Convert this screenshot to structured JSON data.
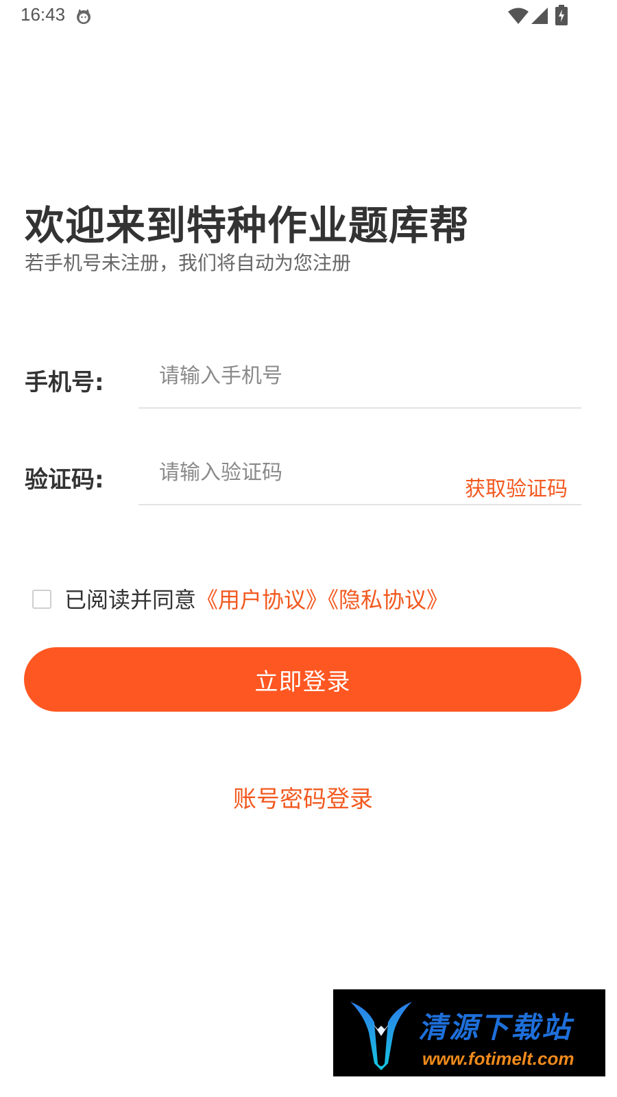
{
  "status_bar": {
    "time": "16:43",
    "icons": [
      "cat-notification-icon",
      "wifi-icon",
      "signal-icon",
      "battery-charging-icon"
    ]
  },
  "header": {
    "title": "欢迎来到特种作业题库帮",
    "subtitle": "若手机号未注册，我们将自动为您注册"
  },
  "form": {
    "phone_label": "手机号:",
    "phone_placeholder": "请输入手机号",
    "phone_value": "",
    "code_label": "验证码:",
    "code_placeholder": "请输入验证码",
    "code_value": "",
    "get_code_label": "获取验证码"
  },
  "agreement": {
    "checked": false,
    "prefix": "已阅读并同意",
    "user_agreement": "《用户协议》",
    "privacy_agreement": "《隐私协议》"
  },
  "actions": {
    "login_label": "立即登录",
    "password_login_label": "账号密码登录"
  },
  "watermark": {
    "name": "清源下载站",
    "url": "www.fotimelt.com"
  },
  "colors": {
    "accent": "#ff5722",
    "link": "#f2591f",
    "title_text": "#333333",
    "subtitle_text": "#666666",
    "placeholder": "#8a8a8a",
    "divider": "#e3e3e3"
  }
}
